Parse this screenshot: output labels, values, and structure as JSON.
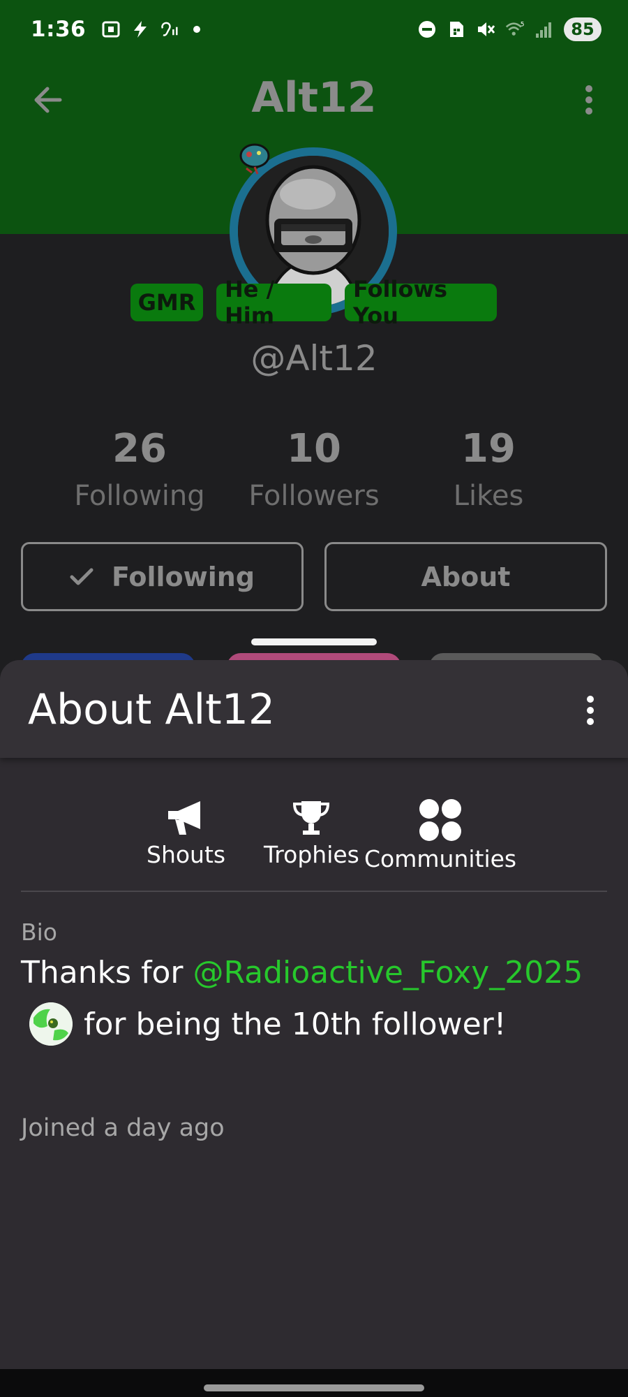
{
  "status_bar": {
    "time": "1:36",
    "battery": "85",
    "left_icons": [
      "screenshot-icon",
      "flash-icon",
      "hearing-icon",
      "notification-dot-icon"
    ],
    "right_icons": [
      "do-not-disturb-icon",
      "sim-icon",
      "mute-icon",
      "wifi-icon",
      "signal-icon"
    ],
    "wifi_label": "5"
  },
  "topbar": {
    "title": "Alt12",
    "background": "#0c5310"
  },
  "profile": {
    "badges": [
      "GMR",
      "He / Him",
      "Follows You"
    ],
    "handle": "@Alt12",
    "stats": [
      {
        "value": "26",
        "label": "Following"
      },
      {
        "value": "10",
        "label": "Followers"
      },
      {
        "value": "19",
        "label": "Likes"
      }
    ],
    "buttons": {
      "following": "Following",
      "about": "About"
    }
  },
  "sheet": {
    "title": "About Alt12",
    "tabs": [
      {
        "label": "Shouts",
        "icon": "megaphone-icon"
      },
      {
        "label": "Trophies",
        "icon": "trophy-icon"
      },
      {
        "label": "Communities",
        "icon": "communities-icon"
      }
    ],
    "bio_label": "Bio",
    "bio_prefix": "Thanks for ",
    "bio_mention": "@Radioactive_Foxy_2025",
    "bio_suffix": "for being the 10th follower!",
    "joined": "Joined a day ago",
    "accent": "#27c82c"
  }
}
